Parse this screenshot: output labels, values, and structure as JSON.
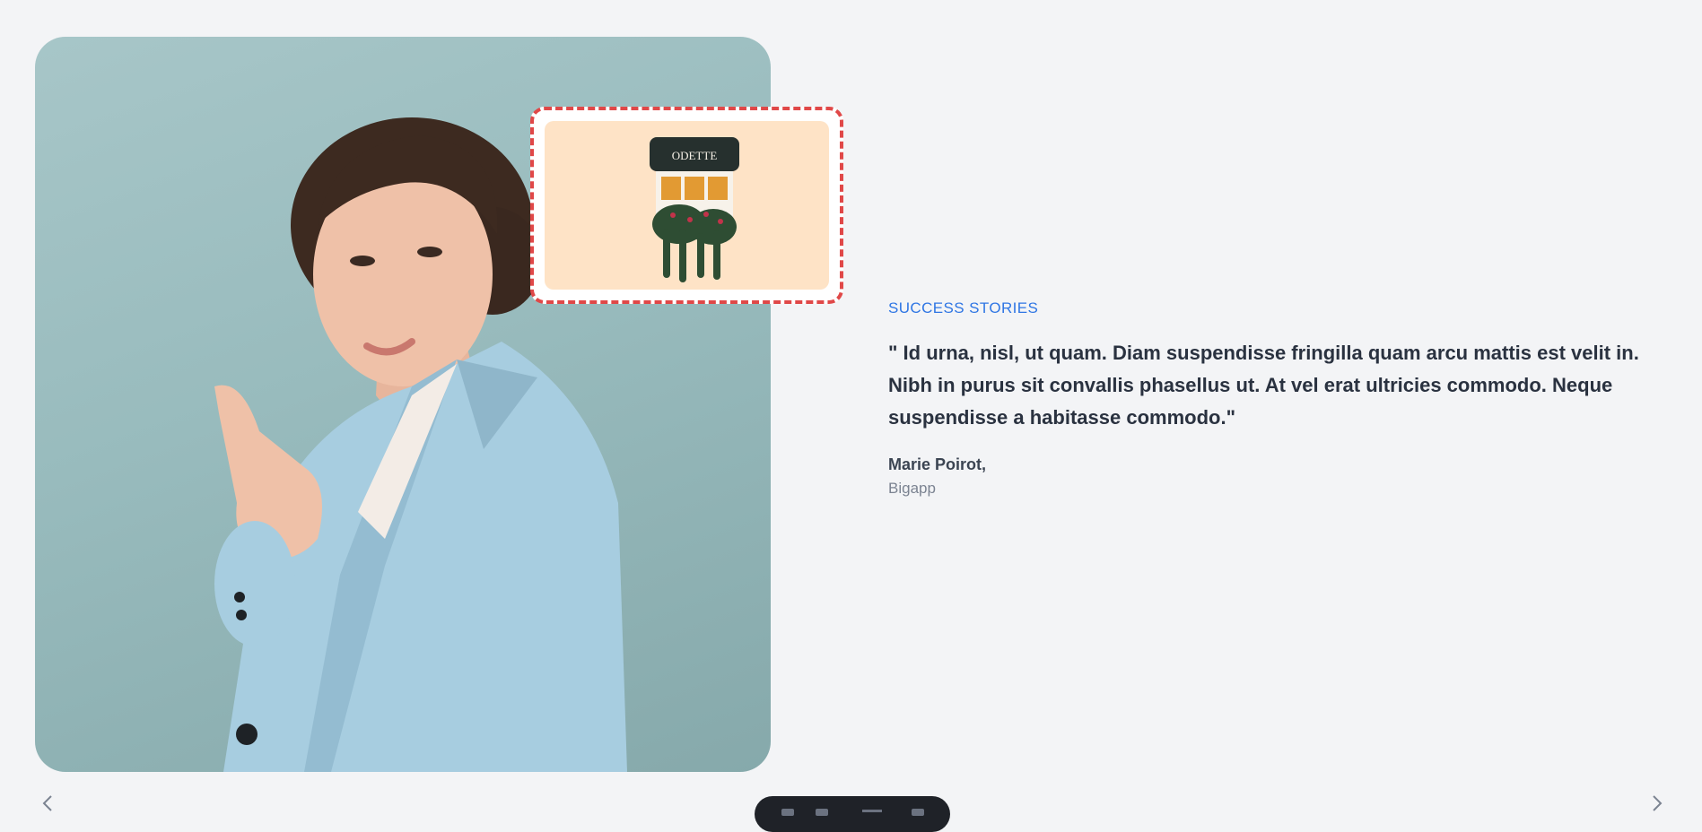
{
  "testimonial": {
    "eyebrow": "SUCCESS STORIES",
    "quote": "\" Id urna, nisl, ut quam. Diam suspendisse fringilla quam arcu mattis est velit in. Nibh in purus sit convallis phasellus ut. At vel erat ultricies commodo. Neque suspendisse a habitasse commodo.\"",
    "author": "Marie Poirot,",
    "company": "Bigapp"
  },
  "logo": {
    "text": "ODETTE"
  },
  "colors": {
    "accent": "#2f76e4",
    "logo_border": "#e04848",
    "background": "#f3f4f6"
  },
  "icons": {
    "prev": "chevron-left-icon",
    "next": "chevron-right-icon"
  }
}
